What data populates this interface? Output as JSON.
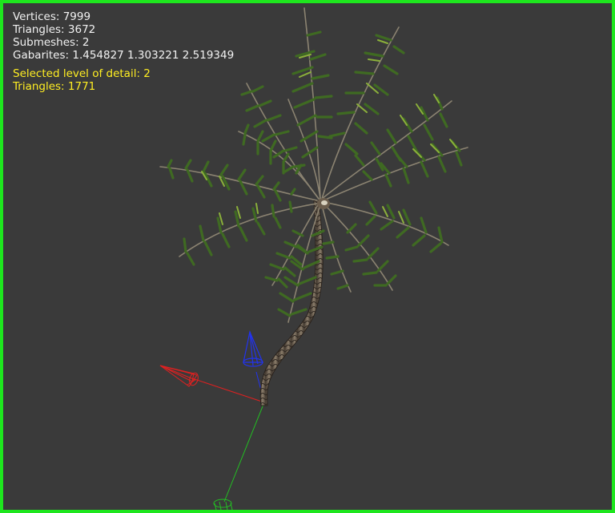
{
  "stats": {
    "vertices": "Vertices: 7999",
    "triangles": "Triangles: 3672",
    "submeshes": "Submeshes: 2",
    "gabarites": "Gabarites: 1.454827 1.303221 2.519349"
  },
  "lod": {
    "selected": "Selected level of detail: 2",
    "triangles": "Triangles: 1771"
  },
  "colors": {
    "frame": "#1ee61e",
    "background": "#3a3a3a",
    "stats_text": "#f2f2f2",
    "lod_text": "#ffee22",
    "axis_x": "#e02020",
    "axis_y": "#22c022",
    "axis_z": "#2233ee"
  },
  "icons": [
    "axis-gizmo-icon",
    "palm-tree-model"
  ]
}
